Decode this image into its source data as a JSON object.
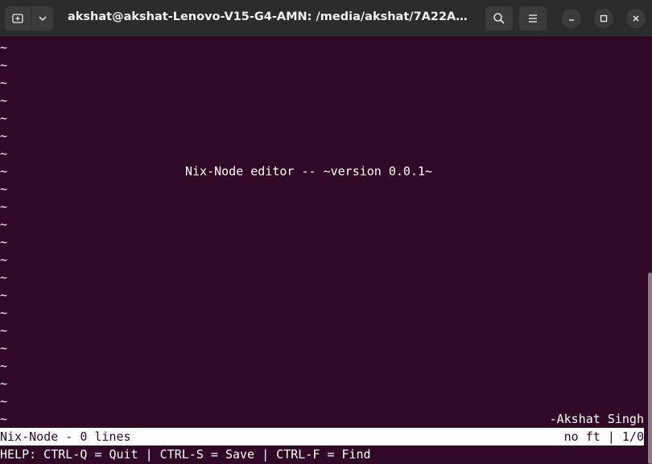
{
  "titlebar": {
    "title": "akshat@akshat-Lenovo-V15-G4-AMN: /media/akshat/7A22A6B822A67...",
    "new_tab_icon": "new-tab-icon",
    "menu_icon": "chevron-down-icon",
    "search_icon": "search-icon",
    "hamburger_icon": "hamburger-menu-icon"
  },
  "editor": {
    "tilde": "~",
    "welcome": "Nix-Node editor -- ~version 0.0.1~",
    "author": "-Akshat Singh"
  },
  "status": {
    "left": "Nix-Node - 0 lines",
    "right": "no ft | 1/0"
  },
  "help": "HELP: CTRL-Q = Quit | CTRL-S = Save | CTRL-F = Find",
  "colors": {
    "terminal_bg": "#300a24",
    "titlebar_bg": "#2c2c2c",
    "text": "#ffffff"
  }
}
